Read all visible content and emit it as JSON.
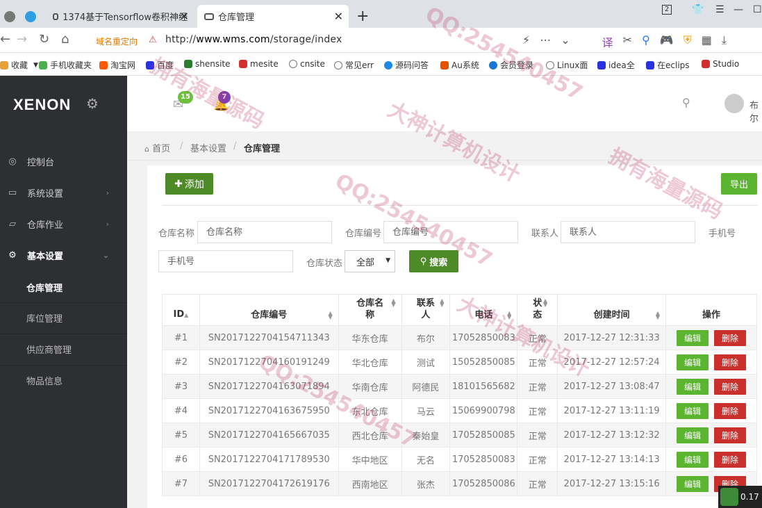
{
  "browser": {
    "tabs": [
      {
        "label": "1374基于Tensorflow卷积神经",
        "active": false
      },
      {
        "label": "仓库管理",
        "active": true
      }
    ],
    "tab_count": "2",
    "redirect_label": "域名重定向",
    "url_prefix": "http://",
    "url_domain": "www.wms.com",
    "url_path": "/storage/index",
    "bookmarks": [
      {
        "label": "收藏",
        "color": "#e9a23b"
      },
      {
        "label": "手机收藏夹",
        "color": "#4caf50"
      },
      {
        "label": "淘宝网",
        "color": "#ff5a00"
      },
      {
        "label": "百度",
        "color": "#2932e1"
      },
      {
        "label": "shensite",
        "color": "#2e7d32"
      },
      {
        "label": "mesite",
        "color": "#d32f2f"
      },
      {
        "label": "cnsite",
        "color": "#777777"
      },
      {
        "label": "常见err",
        "color": "#777777"
      },
      {
        "label": "源码问答",
        "color": "#1e88e5"
      },
      {
        "label": "Au系统",
        "color": "#e65100"
      },
      {
        "label": "会员登录",
        "color": "#1976d2"
      },
      {
        "label": "Linux面",
        "color": "#777777"
      },
      {
        "label": "idea全",
        "color": "#2932e1"
      },
      {
        "label": "在eclips",
        "color": "#2932e1"
      },
      {
        "label": "Studio",
        "color": "#d32f2f"
      }
    ]
  },
  "sidebar": {
    "logo": "XENON",
    "menu": [
      {
        "label": "控制台",
        "icon": "dashboard-icon",
        "chevron": false
      },
      {
        "label": "系统设置",
        "icon": "monitor-icon",
        "chevron": true
      },
      {
        "label": "仓库作业",
        "icon": "tag-icon",
        "chevron": true
      },
      {
        "label": "基本设置",
        "icon": "gear-icon",
        "chevron": true,
        "expanded": true
      }
    ],
    "submenu": [
      {
        "label": "仓库管理",
        "active": true
      },
      {
        "label": "库位管理",
        "active": false
      },
      {
        "label": "供应商管理",
        "active": false
      },
      {
        "label": "物品信息",
        "active": false
      }
    ]
  },
  "header": {
    "mail_count": "15",
    "bell_count": "7",
    "user_name": "布尔"
  },
  "breadcrumb": {
    "home": "首页",
    "level1": "基本设置",
    "current": "仓库管理"
  },
  "toolbar": {
    "add_label": "添加",
    "export_label": "导出"
  },
  "filters": {
    "name_label": "仓库名称",
    "name_placeholder": "仓库名称",
    "code_label": "仓库编号",
    "code_placeholder": "仓库编号",
    "contact_label": "联系人",
    "contact_placeholder": "联系人",
    "phone_label": "手机号",
    "phone_placeholder": "手机号",
    "status_label": "仓库状态",
    "status_value": "全部",
    "search_label": "搜索"
  },
  "table": {
    "headers": {
      "id": "ID",
      "code": "仓库编号",
      "name": "仓库名称",
      "contact": "联系人",
      "phone": "电话",
      "status": "状态",
      "created": "创建时间",
      "ops": "操作"
    },
    "edit_label": "编辑",
    "delete_label": "删除",
    "rows": [
      {
        "id": "#1",
        "code": "SN20171227041547113​43",
        "name": "华东仓库",
        "contact": "布尔",
        "phone": "17052850083",
        "status": "正常",
        "created": "2017-12-27 12:31:33"
      },
      {
        "id": "#2",
        "code": "SN201712270416019124​9",
        "name": "华北仓库",
        "contact": "测试",
        "phone": "15052850085",
        "status": "正常",
        "created": "2017-12-27 12:57:24"
      },
      {
        "id": "#3",
        "code": "SN201712270416307189​4",
        "name": "华南仓库",
        "contact": "阿德民",
        "phone": "18101565682",
        "status": "正常",
        "created": "2017-12-27 13:08:47"
      },
      {
        "id": "#4",
        "code": "SN201712270416367595​0",
        "name": "东北仓库",
        "contact": "马云",
        "phone": "15069900798",
        "status": "正常",
        "created": "2017-12-27 13:11:19"
      },
      {
        "id": "#5",
        "code": "SN201712270416566703​5",
        "name": "西北仓库",
        "contact": "秦始皇",
        "phone": "17052850085",
        "status": "正常",
        "created": "2017-12-27 13:12:32"
      },
      {
        "id": "#6",
        "code": "SN201712270417178953​0",
        "name": "华中地区",
        "contact": "无名",
        "phone": "17052850083",
        "status": "正常",
        "created": "2017-12-27 13:14:13"
      },
      {
        "id": "#7",
        "code": "SN201712270417261917​6",
        "name": "西南地区",
        "contact": "张杰",
        "phone": "17052850086",
        "status": "正常",
        "created": "2017-12-27 13:15:16"
      }
    ]
  },
  "overlay": {
    "floating_value": "0.17",
    "watermarks": [
      "QQ:254540457",
      "拥有海量源码",
      "大神计算机设计"
    ]
  }
}
